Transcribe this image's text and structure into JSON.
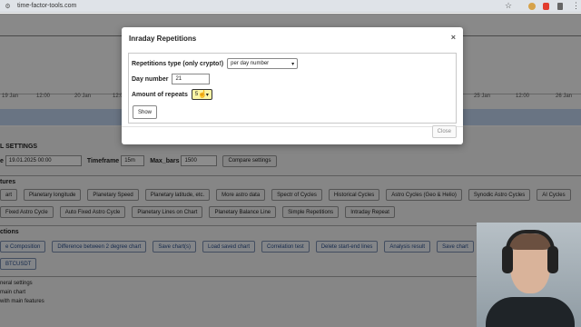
{
  "browser": {
    "url": "time-factor-tools.com"
  },
  "chart": {
    "x_ticks": [
      "19 Jan",
      "12:00",
      "20 Jan",
      "12:00",
      "25 Jan",
      "12:00",
      "26 Jan"
    ]
  },
  "settings": {
    "title": "L SETTINGS",
    "date_label": "e",
    "date_value": "19.01.2025 00:00",
    "timeframe_label": "Timeframe",
    "timeframe_value": "15m",
    "max_bars_label": "Max_bars",
    "max_bars_value": "1500",
    "compare_button": "Compare settings"
  },
  "features": {
    "title": "tures",
    "row1": [
      "art",
      "Planetary longitude",
      "Planetary Speed",
      "Planetary latitude, etc.",
      "More astro data",
      "Spectr of Cycles",
      "Historical Cycles",
      "Astro Cycles (Geo & Helio)",
      "Synodic Astro Cycles",
      "AI Cycles"
    ],
    "row2": [
      "Fixed Astro Cycle",
      "Auto Fixed Astro Cycle",
      "Planetary Lines on Chart",
      "Planetary Balance Line",
      "Simple Repetitions",
      "Intraday Repeat"
    ]
  },
  "actions": {
    "title": "ctions",
    "row1": [
      "e Composition",
      "Difference between 2 degree chart",
      "Save chart(s)",
      "Load saved chart",
      "Correlation test",
      "Delete start-end lines",
      "Analysis result",
      "Save chart"
    ],
    "symbol": "BTCUSDT"
  },
  "footer_list": [
    "neral settings",
    "main chart",
    "with main features"
  ],
  "modal": {
    "title": "Inraday Repetitions",
    "close_symbol": "×",
    "type_label": "Repetitions type (only crypto!)",
    "type_value": "per day number",
    "day_label": "Day number",
    "day_value": "21",
    "repeats_label": "Amount of repeats",
    "repeats_value": "5",
    "show_button": "Show",
    "close_button": "Close"
  }
}
